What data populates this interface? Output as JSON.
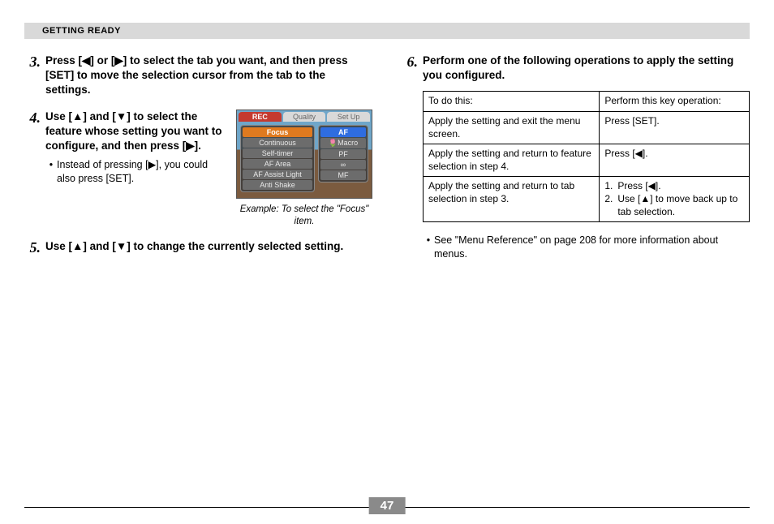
{
  "header": "GETTING READY",
  "left": {
    "step3": {
      "num": "3.",
      "text": "Press [◀] or [▶] to select the tab you want, and then press [SET] to move the selection cursor from the tab to the settings."
    },
    "step4": {
      "num": "4.",
      "text": "Use [▲] and [▼] to select the feature whose setting you want to configure, and then press [▶].",
      "bullet": "Instead of pressing [▶], you could also press [SET].",
      "caption": "Example: To select the \"Focus\" item."
    },
    "step5": {
      "num": "5.",
      "text": "Use [▲] and [▼] to change the currently selected setting."
    }
  },
  "right": {
    "step6": {
      "num": "6.",
      "text": "Perform one of the following operations to apply the setting you configured."
    },
    "table": {
      "h1": "To do this:",
      "h2": "Perform this key operation:",
      "rows": [
        {
          "a": "Apply the setting and exit the menu screen.",
          "b": "Press [SET]."
        },
        {
          "a": "Apply the setting and return to feature selection in step 4.",
          "b": "Press [◀]."
        },
        {
          "a": "Apply the setting and return to tab selection in step 3.",
          "b1n": "1.",
          "b1": "Press [◀].",
          "b2n": "2.",
          "b2": "Use [▲] to move back up to tab selection."
        }
      ]
    },
    "note": "See \"Menu Reference\" on page 208 for more information about menus."
  },
  "menu": {
    "tabs": [
      "REC",
      "Quality",
      "Set Up"
    ],
    "items": [
      "Focus",
      "Continuous",
      "Self-timer",
      "AF Area",
      "AF Assist Light",
      "Anti Shake"
    ],
    "values": [
      "AF",
      "🌷Macro",
      "PF",
      "∞",
      "MF"
    ]
  },
  "pagenum": "47"
}
